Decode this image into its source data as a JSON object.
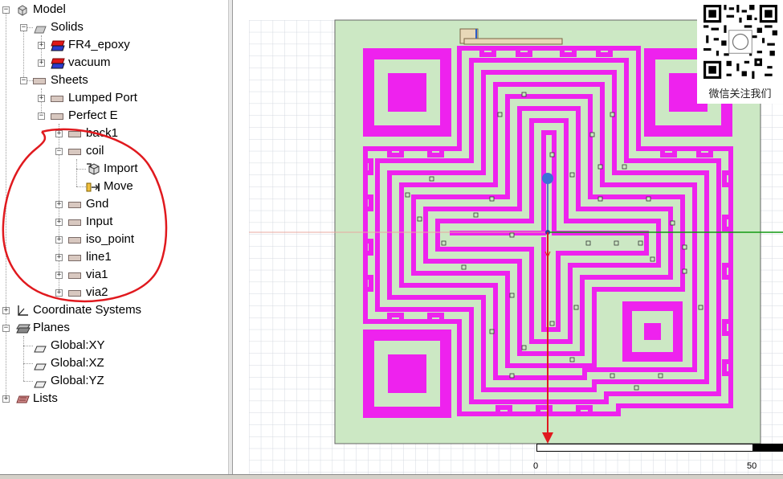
{
  "tree": {
    "model": {
      "label": "Model"
    },
    "solids": {
      "label": "Solids"
    },
    "fr4": {
      "label": "FR4_epoxy"
    },
    "vacuum": {
      "label": "vacuum"
    },
    "sheets": {
      "label": "Sheets"
    },
    "lumped": {
      "label": "Lumped Port"
    },
    "perfect": {
      "label": "Perfect E"
    },
    "back1": {
      "label": "back1"
    },
    "coil": {
      "label": "coil"
    },
    "import": {
      "label": "Import"
    },
    "move": {
      "label": "Move"
    },
    "gnd": {
      "label": "Gnd"
    },
    "input": {
      "label": "Input"
    },
    "iso": {
      "label": "iso_point"
    },
    "line1": {
      "label": "line1"
    },
    "via1": {
      "label": "via1"
    },
    "via2": {
      "label": "via2"
    },
    "coords": {
      "label": "Coordinate Systems"
    },
    "planes": {
      "label": "Planes"
    },
    "gxy": {
      "label": "Global:XY"
    },
    "gxz": {
      "label": "Global:XZ"
    },
    "gyz": {
      "label": "Global:YZ"
    },
    "lists": {
      "label": "Lists"
    }
  },
  "overlay": {
    "qr_caption": "微信关注我们"
  },
  "scale": {
    "left": "0",
    "right": "50"
  },
  "colors": {
    "substrate": "#cce8c4",
    "trace": "#ee22ee",
    "grid": "#d4d8e0",
    "annotation": "#e0191e",
    "x_axis": "#e0191e",
    "y_axis": "#119911"
  }
}
